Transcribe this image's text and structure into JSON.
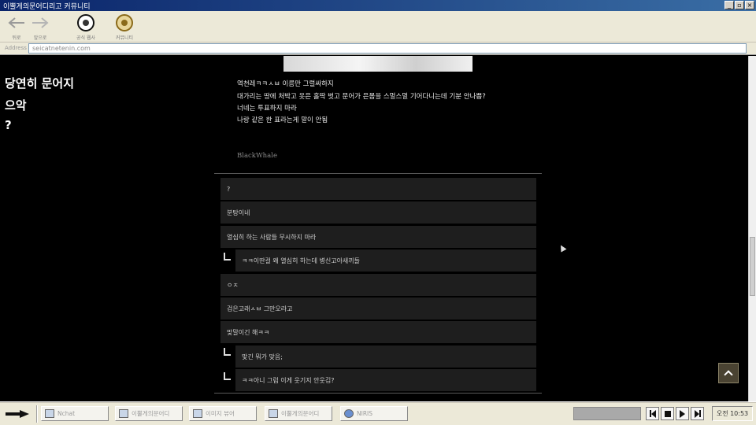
{
  "window": {
    "title": "이뿔게의문어디리고 커뮤니티",
    "controls": [
      "_",
      "▫",
      "×"
    ]
  },
  "toolbar": {
    "back_label": "뒤로",
    "forward_label": "앞으로",
    "emblem1_label": "공식 웹사",
    "emblem2_label": "커뮤니티"
  },
  "address": {
    "label": "Address",
    "url": "seicatnetenin.com"
  },
  "sidebar_text": [
    "당연히 문어지",
    "으악",
    "?"
  ],
  "post": {
    "lines": [
      "역천레ㅋㅋㅅㅂ 이름만 그럴싸하지",
      "대가리는 땅에 처박고 옷은 홀딱 벗고 문어가 은몸을 스멀스멀 기어다니는데 기분 안나쁨?",
      "너네는 투표하지 마라",
      "나랑 같은 한 표라는게 말이 안됨"
    ],
    "author": "BlackWhale"
  },
  "comments": [
    {
      "text": "?",
      "reply": false
    },
    {
      "text": "분탕이네",
      "reply": false
    },
    {
      "text": "열심히 하는 사람들 무시하지 마라",
      "reply": false
    },
    {
      "text": "ㅋㅋ이딴걸 왜 열심히 하는데 병신고아새끼들",
      "reply": true
    },
    {
      "text": "ㅇㅈ",
      "reply": false
    },
    {
      "text": "검은고래ㅅㅂ 그만오라고",
      "reply": false
    },
    {
      "text": "맞말이긴 해ㅋㅋ",
      "reply": false
    },
    {
      "text": "맞긴 뭐가 맞음;",
      "reply": true
    },
    {
      "text": "ㅋㅋ아니 그럼 이게 웃기지 안웃김?",
      "reply": true
    }
  ],
  "taskbar": {
    "tasks": [
      {
        "label": "Nchat",
        "icon": "chat-icon"
      },
      {
        "label": "이뿔게의문어디",
        "icon": "window-icon"
      },
      {
        "label": "이미지 뷰어",
        "icon": "image-icon"
      },
      {
        "label": "이뿔게의문어디",
        "icon": "window-icon"
      },
      {
        "label": "NIRIS",
        "icon": "ie-icon"
      }
    ],
    "clock": "오전 10:53"
  },
  "colors": {
    "page_bg": "#000000",
    "comment_bg": "#1e1e1e",
    "titlebar": "#0a246a",
    "taskbar": "#ece9d8",
    "totop_bg": "#4a4332"
  }
}
